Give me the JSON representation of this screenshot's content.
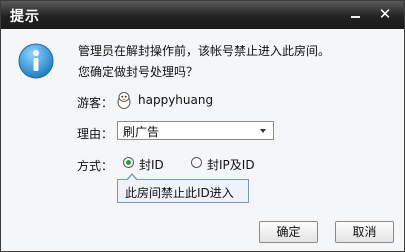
{
  "dialog": {
    "title": "提示",
    "message_line1": "管理员在解封操作前，该帐号禁止进入此房间。",
    "message_line2": "您确定做封号处理吗？",
    "guest_label": "游客：",
    "guest_name": "happyhuang",
    "reason_label": "理由：",
    "reason_value": "刷广告",
    "method_label": "方式：",
    "options": [
      {
        "label": "封ID",
        "checked": true
      },
      {
        "label": "封IP及ID",
        "checked": false
      }
    ],
    "tooltip": "此房间禁止此ID进入",
    "ok_label": "确定",
    "cancel_label": "取消"
  },
  "icons": [
    "minimize-icon",
    "close-icon",
    "info-icon",
    "guest-avatar-icon",
    "dropdown-arrow-icon"
  ],
  "colors": {
    "titlebar": "#2a2a2a",
    "info_icon": "#2f9bd8",
    "radio_checked": "#2b9a35",
    "tooltip_border": "#7d97b8"
  }
}
